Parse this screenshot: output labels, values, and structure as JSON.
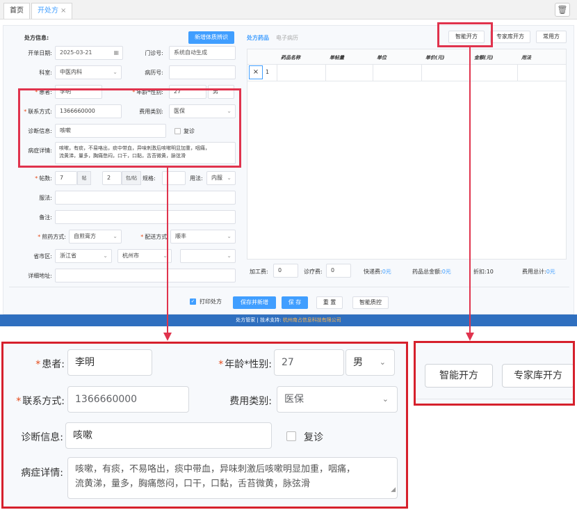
{
  "tabs": {
    "home": "首页",
    "active": "开处方",
    "close": "×"
  },
  "form": {
    "section_title": "处方信息:",
    "new_sense_btn": "新增体质辨识",
    "date_label": "开单日期:",
    "date_value": "2025-03-21",
    "clinic_label": "门诊号:",
    "clinic_value": "系统自动生成",
    "dept_label": "科室:",
    "dept_value": "中医内科",
    "record_label": "病历号:",
    "record_value": "",
    "patient_label": "患者:",
    "patient_value": "李明",
    "age_label": "年龄*性别:",
    "age_value": "27",
    "gender_value": "男",
    "contact_label": "联系方式:",
    "contact_value": "1366660000",
    "fee_label": "费用类别:",
    "fee_value": "医保",
    "diag_label": "诊断信息:",
    "diag_value": "咳嗽",
    "revisit_label": "复诊",
    "symptom_label": "病症详情:",
    "symptom_line1": "咳嗽，有痰，不易咯出，痰中带血，异味刺激后咳嗽明显加重，咽痛，",
    "symptom_line2": "流黄涕，量多，胸痛憋闷，口干，口黏，舌苔微黄，脉弦滑",
    "dose_label": "帖数:",
    "dose_value": "7",
    "dose_unit": "帖",
    "pack_value": "2",
    "pack_unit": "包/帖",
    "spec_label": "规格:",
    "usage_label": "用法:",
    "usage_value": "内服",
    "take_label": "服法:",
    "note_label": "备注:",
    "decoct_label": "煎药方式:",
    "decoct_value": "自煎膏方",
    "delivery_label": "配送方式:",
    "delivery_value": "顺丰",
    "region_label": "省市区:",
    "province": "浙江省",
    "city": "杭州市",
    "address_label": "详细地址:"
  },
  "rx": {
    "tab_drug": "处方药品",
    "tab_emr": "电子病历",
    "btn_smart": "智能开方",
    "btn_expert": "专家库开方",
    "btn_common": "常用方",
    "columns": [
      "药品名称",
      "单帖量",
      "单位",
      "单价(元)",
      "金额(元)",
      "用法"
    ],
    "row_num": "1",
    "row_del": "×",
    "fee_process_label": "加工费:",
    "fee_process": "0",
    "fee_diag_label": "诊疗费:",
    "fee_diag": "0",
    "express_label": "快递费:",
    "express": "0元",
    "drug_total_label": "药品总金额:",
    "drug_total": "0元",
    "discount_label": "折扣:",
    "discount": "10",
    "cost_total_label": "费用总计:",
    "cost_total": "0元"
  },
  "actions": {
    "print_label": "打印处方",
    "save_new": "保存并新增",
    "save": "保 存",
    "reset": "重 置",
    "smart_qc": "智能质控"
  },
  "footer": {
    "text": "处方管家 | 技术支持:",
    "org": "杭州南占信息科技有限公司"
  },
  "colors": {
    "accent": "#409eff",
    "highlight": "#e0334d",
    "footer": "#2f6fbf"
  }
}
